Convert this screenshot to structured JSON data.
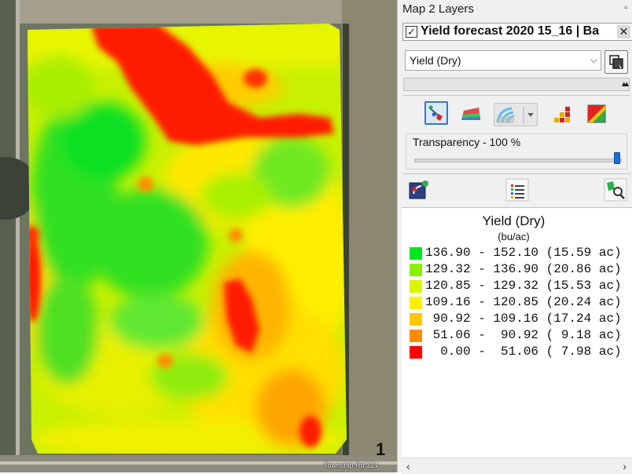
{
  "map": {
    "road_label": "Township Rd 324",
    "north_indicator": "1"
  },
  "panel": {
    "title": "Map 2 Layers",
    "layer": {
      "checked": true,
      "check_mark": "✓",
      "name": "Yield forecast 2020 15_16 | Ba",
      "close_glyph": "✕"
    },
    "attribute_select": {
      "value": "Yield (Dry)",
      "chevron": "⌵"
    },
    "collapse_glyph": "▴▴",
    "toolbar_icons": [
      "style-points-icon",
      "style-surface-icon",
      "style-contour-icon",
      "dropdown-arrow-icon",
      "legend-bars-icon",
      "color-ramp-icon"
    ],
    "transparency": {
      "label": "Transparency - 100 %",
      "value_percent": 100
    },
    "bottom_icons": [
      "refresh-layer-icon",
      "list-settings-icon",
      "zoom-layer-icon"
    ]
  },
  "legend": {
    "title": "Yield (Dry)",
    "unit": "(bu/ac)",
    "rows": [
      {
        "text": "136.90 - 152.10 (15.59 ac)",
        "color": "#00e61e"
      },
      {
        "text": "129.32 - 136.90 (20.86 ac)",
        "color": "#8cf000"
      },
      {
        "text": "120.85 - 129.32 (15.53 ac)",
        "color": "#d8f500"
      },
      {
        "text": "109.16 - 120.85 (20.24 ac)",
        "color": "#fff000"
      },
      {
        "text": " 90.92 - 109.16 (17.24 ac)",
        "color": "#ffc800"
      },
      {
        "text": " 51.06 -  90.92 ( 9.18 ac)",
        "color": "#ff8c00"
      },
      {
        "text": "  0.00 -  51.06 ( 7.98 ac)",
        "color": "#ff0000"
      }
    ],
    "scroll_left": "‹",
    "scroll_right": "›"
  },
  "colors": {
    "high": "#00e61e",
    "mid_high": "#8cf000",
    "mid": "#d8f500",
    "mid_low": "#fff000",
    "low": "#ffc800",
    "very_low": "#ff8c00",
    "lowest": "#ff0000",
    "satellite_background": "#6d7560"
  }
}
